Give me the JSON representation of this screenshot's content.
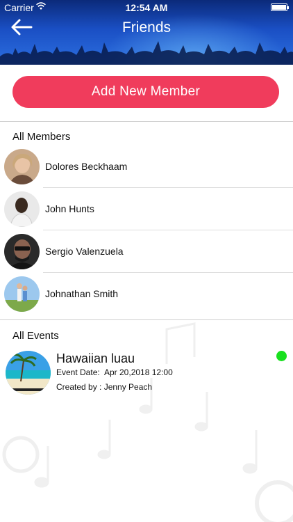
{
  "status_bar": {
    "carrier": "Carrier",
    "time": "12:54 AM"
  },
  "header": {
    "title": "Friends",
    "back_icon": "arrow-left-icon"
  },
  "add_button_label": "Add New Member",
  "members_section": {
    "title": "All Members",
    "items": [
      {
        "name": "Dolores Beckhaam"
      },
      {
        "name": "John Hunts"
      },
      {
        "name": "Sergio Valenzuela"
      },
      {
        "name": "Johnathan Smith"
      }
    ]
  },
  "events_section": {
    "title": "All Events",
    "items": [
      {
        "name": "Hawaiian luau",
        "date_label": "Event Date:",
        "date": "Apr 20,2018 12:00",
        "created_by": "Created by :  Jenny Peach",
        "status_color": "#19e01f"
      }
    ]
  },
  "colors": {
    "accent": "#f03c5c",
    "header": "#1a4fc4",
    "status_online": "#19e01f"
  }
}
